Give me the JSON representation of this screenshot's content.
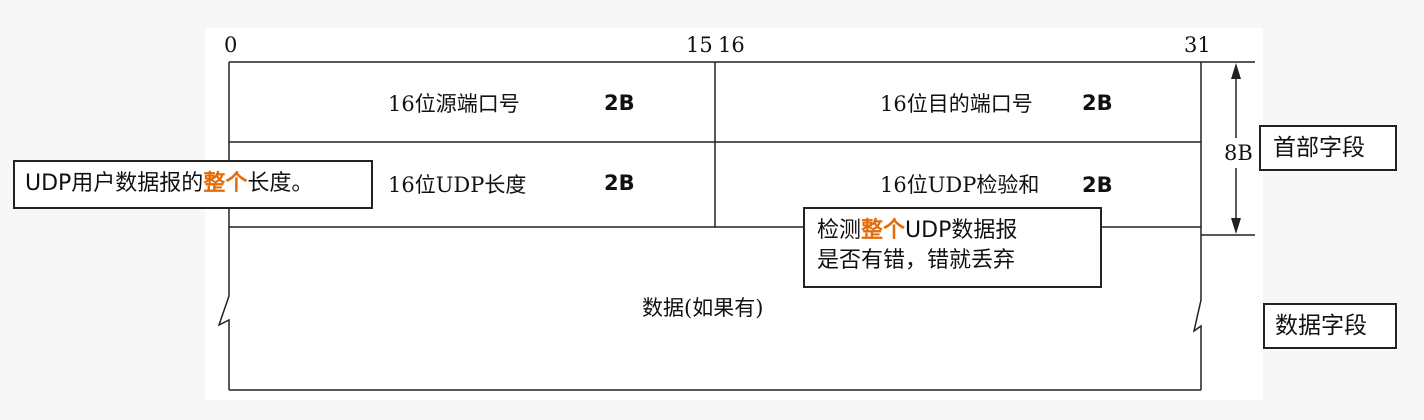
{
  "bits": {
    "b0": "0",
    "b15": "15",
    "b16": "16",
    "b31": "31"
  },
  "fields": {
    "src_port": "16位源端口号",
    "dst_port": "16位目的端口号",
    "length": "16位UDP长度",
    "checksum": "16位UDP检验和",
    "data": "数据(如果有)"
  },
  "sizes": {
    "src_port": "2B",
    "dst_port": "2B",
    "length": "2B",
    "checksum": "2B",
    "header": "8B"
  },
  "labels": {
    "header_field": "首部字段",
    "data_field": "数据字段"
  },
  "callouts": {
    "length_note": {
      "pre": "UDP用户数据报的",
      "hl": "整个",
      "post": "长度。"
    },
    "checksum_note": {
      "line1_pre": "检测",
      "line1_hl": "整个",
      "line1_post": "UDP数据报",
      "line2": "是否有错，错就丢弃"
    }
  },
  "colors": {
    "highlight": "#e46c0a",
    "line": "#222222"
  }
}
